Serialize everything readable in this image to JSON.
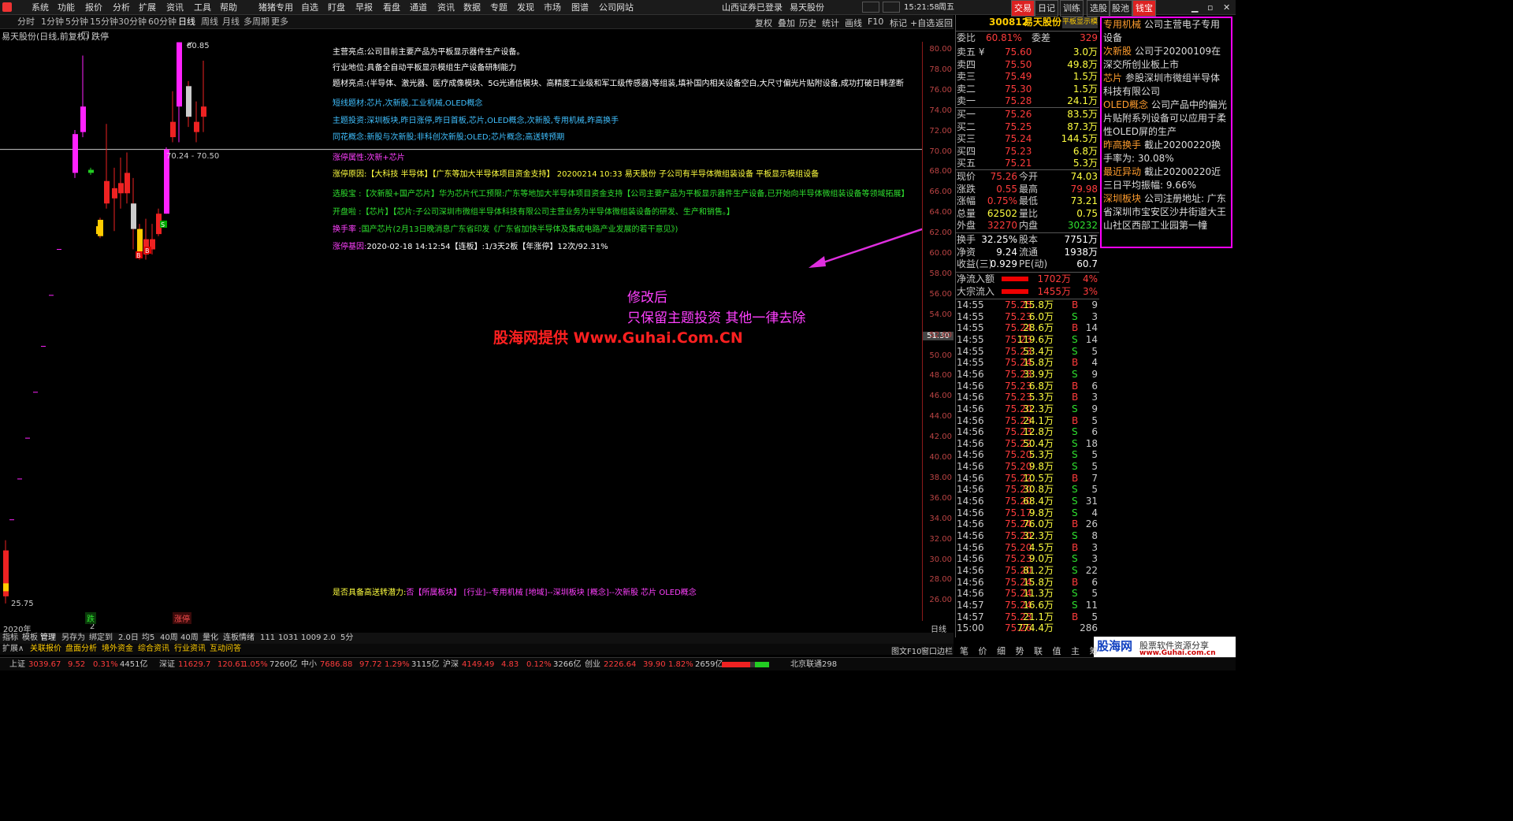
{
  "menu": {
    "items": [
      "系统",
      "功能",
      "报价",
      "分析",
      "扩展",
      "资讯",
      "工具",
      "帮助",
      "猪猪专用",
      "自选",
      "盯盘",
      "早报",
      "看盘",
      "通道",
      "资讯",
      "数据",
      "专题",
      "发现",
      "市场",
      "图谱",
      "公司网站"
    ],
    "broker": "山西证券已登录",
    "stock": "易天股份",
    "time": "15:21:58",
    "weekday": "周五",
    "right_tabs": [
      "交易",
      "日记",
      "训练",
      "选股",
      "股池",
      "钱宝"
    ]
  },
  "timeframes": [
    "分时",
    "1分钟",
    "5分钟",
    "15分钟",
    "30分钟",
    "60分钟",
    "日线",
    "周线",
    "月线",
    "多周期",
    "更多"
  ],
  "toolbar": [
    "复权",
    "叠加",
    "历史",
    "统计",
    "画线",
    "F10",
    "标记",
    "+自选",
    "返回"
  ],
  "title": {
    "name": "易天股份(日线,前复权)",
    "indicator": "跌停"
  },
  "chart": {
    "high_label": "80.85",
    "low_label": "25.75",
    "range_label": "70.24 - 70.50",
    "crosshair_price": "51.30",
    "year_label": "2020年",
    "month_label": "2",
    "y_ticks": [
      "80.00",
      "78.00",
      "76.00",
      "74.00",
      "72.00",
      "70.00",
      "68.00",
      "66.00",
      "64.00",
      "62.00",
      "60.00",
      "58.00",
      "56.00",
      "54.00",
      "52.00",
      "50.00",
      "48.00",
      "46.00",
      "44.00",
      "42.00",
      "40.00",
      "38.00",
      "36.00",
      "34.00",
      "32.00",
      "30.00",
      "28.00",
      "26.00"
    ],
    "marker_up": "B",
    "marker_down": "S",
    "bottom_tags": [
      "跌",
      "涨停"
    ]
  },
  "info": {
    "main_business": {
      "label": "主营亮点:",
      "text": "公司目前主要产品为平板显示器件生产设备。"
    },
    "industry": {
      "label": "行业地位:",
      "text": "具备全自动平板显示模组生产设备研制能力"
    },
    "theme": {
      "label": "题材亮点:",
      "text": "(半导体、激光器、医疗成像模块、5G光通信模块、高精度工业级和军工级传感器)等组装,填补国内相关设备空白,大尺寸偏光片贴附设备,成功打破日韩垄断"
    },
    "short_line": {
      "label": "短线题材:",
      "text": "芯片,次新股,工业机械,OLED概念"
    },
    "theme_invest": {
      "label": "主题投资:",
      "text": "深圳板块,昨日涨停,昨日首板,芯片,OLED概念,次新股,专用机械,昨高换手"
    },
    "ths_concept": {
      "label": "同花概念:",
      "text": "新股与次新股;非科创次新股;OLED;芯片概念;高送转预期"
    },
    "limit_attr": {
      "label": "涨停属性:",
      "text": "次新+芯片"
    },
    "limit_reason": {
      "label": "涨停原因:",
      "text": "【大科技 半导体】【广东等加大半导体项目资金支持】 20200214 10:33 易天股份 子公司有半导体微组装设备 平板显示模组设备"
    },
    "pick_treasure": {
      "label": "选股宝 :",
      "text": "【次新股+国产芯片】华为芯片代工预限:广东等地加大半导体项目资金支持【公司主要产品为平板显示器件生产设备,已开始向半导体微组装设备等领域拓展】"
    },
    "kpl": {
      "label": "开盘啦 :",
      "text": "【芯片】【芯片:子公司深圳市微组半导体科技有限公司主营业务为半导体微组装设备的研发、生产和销售。】"
    },
    "turnover_hand": {
      "label": "换手率 :",
      "text": "国产芯片(2月13日晚消息广东省印发《广东省加快半导体及集成电路产业发展的若干意见》)"
    },
    "limit_gene": {
      "label": "涨停基因:",
      "text": "2020-02-18 14:12:54【连板】:1/3天2板【年涨停】12次/92.31%"
    },
    "high_send": {
      "label": "是否具备高送转潜力:",
      "text": "否【所属板块】 [行业]--专用机械 [地域]--深圳板块 [概念]--次新股 芯片 OLED概念"
    }
  },
  "annotation": {
    "line1": "修改后",
    "line2": "只保留主题投资  其他一律去除",
    "watermark": "股海网提供 Www.Guhai.Com.CN"
  },
  "quote": {
    "code": "300812",
    "name": "易天股份",
    "header_tag": "平板显示模",
    "weibi": {
      "label": "委比",
      "value": "60.81%",
      "label2": "委差",
      "value2": "329"
    },
    "asks": [
      {
        "label": "卖五 ¥",
        "price": "75.60",
        "vol": "3.0万"
      },
      {
        "label": "卖四",
        "price": "75.50",
        "vol": "49.8万"
      },
      {
        "label": "卖三",
        "price": "75.49",
        "vol": "1.5万"
      },
      {
        "label": "卖二",
        "price": "75.30",
        "vol": "1.5万"
      },
      {
        "label": "卖一",
        "price": "75.28",
        "vol": "24.1万"
      }
    ],
    "bids": [
      {
        "label": "买一",
        "price": "75.26",
        "vol": "83.5万"
      },
      {
        "label": "买二",
        "price": "75.25",
        "vol": "87.3万"
      },
      {
        "label": "买三",
        "price": "75.24",
        "vol": "144.5万"
      },
      {
        "label": "买四",
        "price": "75.23",
        "vol": "6.8万"
      },
      {
        "label": "买五",
        "price": "75.21",
        "vol": "5.3万"
      }
    ],
    "stats": [
      {
        "l1": "现价",
        "v1": "75.26",
        "l2": "今开",
        "v2": "74.03"
      },
      {
        "l1": "涨跌",
        "v1": "0.55",
        "l2": "最高",
        "v2": "79.98"
      },
      {
        "l1": "涨幅",
        "v1": "0.75%",
        "l2": "最低",
        "v2": "73.21"
      },
      {
        "l1": "总量",
        "v1": "62502",
        "l2": "量比",
        "v2": "0.75"
      },
      {
        "l1": "外盘",
        "v1": "32270",
        "l2": "内盘",
        "v2": "30232"
      }
    ],
    "stats2": [
      {
        "l1": "换手",
        "v1": "32.25%",
        "l2": "股本",
        "v2": "7751万"
      },
      {
        "l1": "净资",
        "v1": "9.24",
        "l2": "流通",
        "v2": "1938万"
      },
      {
        "l1": "收益(三)",
        "v1": "0.929",
        "l2": "PE(动)",
        "v2": "60.7"
      }
    ],
    "flows": [
      {
        "label": "净流入额",
        "value": "1702万",
        "pct": "4%"
      },
      {
        "label": "大宗流入",
        "value": "1455万",
        "pct": "3%"
      }
    ],
    "ticks": [
      [
        "14:55",
        "75.25",
        "15.8万",
        "B",
        "9"
      ],
      [
        "14:55",
        "75.23",
        "6.0万",
        "S",
        "3"
      ],
      [
        "14:55",
        "75.24",
        "28.6万",
        "B",
        "14"
      ],
      [
        "14:55",
        "75.23",
        "119.6万",
        "S",
        "14"
      ],
      [
        "14:55",
        "75.23",
        "53.4万",
        "S",
        "5"
      ],
      [
        "14:55",
        "75.24",
        "15.8万",
        "B",
        "4"
      ],
      [
        "14:56",
        "75.23",
        "33.9万",
        "S",
        "9"
      ],
      [
        "14:56",
        "75.23",
        "6.8万",
        "B",
        "6"
      ],
      [
        "14:56",
        "75.23",
        "5.3万",
        "B",
        "3"
      ],
      [
        "14:56",
        "75.20",
        "32.3万",
        "S",
        "9"
      ],
      [
        "14:56",
        "75.23",
        "24.1万",
        "B",
        "5"
      ],
      [
        "14:56",
        "75.23",
        "12.8万",
        "S",
        "6"
      ],
      [
        "14:56",
        "75.22",
        "50.4万",
        "S",
        "18"
      ],
      [
        "14:56",
        "75.20",
        "5.3万",
        "S",
        "5"
      ],
      [
        "14:56",
        "75.20",
        "9.8万",
        "S",
        "5"
      ],
      [
        "14:56",
        "75.22",
        "10.5万",
        "B",
        "7"
      ],
      [
        "14:56",
        "75.20",
        "30.8万",
        "S",
        "5"
      ],
      [
        "14:56",
        "75.20",
        "68.4万",
        "S",
        "31"
      ],
      [
        "14:56",
        "75.17",
        "9.8万",
        "S",
        "4"
      ],
      [
        "14:56",
        "75.24",
        "76.0万",
        "B",
        "26"
      ],
      [
        "14:56",
        "75.20",
        "32.3万",
        "S",
        "8"
      ],
      [
        "14:56",
        "75.20",
        "4.5万",
        "B",
        "3"
      ],
      [
        "14:56",
        "75.23",
        "9.0万",
        "S",
        "3"
      ],
      [
        "14:56",
        "75.20",
        "81.2万",
        "S",
        "22"
      ],
      [
        "14:56",
        "75.24",
        "15.8万",
        "B",
        "6"
      ],
      [
        "14:56",
        "75.24",
        "11.3万",
        "S",
        "5"
      ],
      [
        "14:57",
        "75.24",
        "16.6万",
        "S",
        "11"
      ],
      [
        "14:57",
        "75.23",
        "21.1万",
        "B",
        "5"
      ],
      [
        "15:00",
        "75.26",
        "774.4万",
        "",
        "286"
      ]
    ]
  },
  "f10": [
    {
      "title": "专用机械",
      "text": "公司主营电子专用设备"
    },
    {
      "title": "次新股",
      "text": "公司于20200109在深交所创业板上市"
    },
    {
      "title": "芯片",
      "text": "参股深圳市微组半导体科技有限公司"
    },
    {
      "title": "OLED概念",
      "text": "公司产品中的偏光片贴附系列设备可以应用于柔性OLED屏的生产"
    },
    {
      "title": "昨高换手",
      "text": "截止20200220换手率为: 30.08%"
    },
    {
      "title": "最近异动",
      "text": "截止20200220近三日平均振幅: 9.66%"
    },
    {
      "title": "深圳板块",
      "text": "公司注册地址: 广东省深圳市宝安区沙井街道大王山社区西部工业园第一幢"
    }
  ],
  "tabs1": [
    "指标",
    "模板",
    "管理",
    "另存为",
    "绑定到",
    "2.0日",
    "均5",
    "40周",
    "40周",
    "量化",
    "连板情绪",
    "111",
    "1031",
    "1009",
    "2.0",
    "5分"
  ],
  "tabs2": [
    "扩展∧",
    "关联报价",
    "盘面分析",
    "境外资金",
    "综合资讯",
    "行业资讯",
    "互动问答"
  ],
  "period_label": "日线",
  "f10_toggle": [
    "图文F10",
    "窗口边栏"
  ],
  "right_bottom_tabs": [
    "笔",
    "价",
    "细",
    "势",
    "联",
    "值",
    "主",
    "筹"
  ],
  "status": {
    "sh": {
      "name": "上证",
      "idx": "3039.67",
      "chg": "9.52",
      "pct": "0.31%",
      "amt": "4451亿"
    },
    "sz": {
      "name": "深证",
      "idx": "11629.7",
      "chg": "120.61",
      "pct": "1.05%",
      "amt": "7260亿"
    },
    "zx": {
      "name": "中小",
      "idx": "7686.88",
      "chg": "97.72",
      "pct": "1.29%",
      "amt": "3115亿"
    },
    "hs": {
      "name": "沪深",
      "idx": "4149.49",
      "chg": "4.83",
      "pct": "0.12%",
      "amt": "3266亿"
    },
    "cy": {
      "name": "创业",
      "idx": "2226.64",
      "chg": "39.90",
      "pct": "1.82%",
      "amt": "2659亿"
    },
    "conn": "北京联通298"
  },
  "brand": {
    "name": "股海网",
    "sub": "股票软件资源分享",
    "url": "www.Guhai.com.cn"
  }
}
